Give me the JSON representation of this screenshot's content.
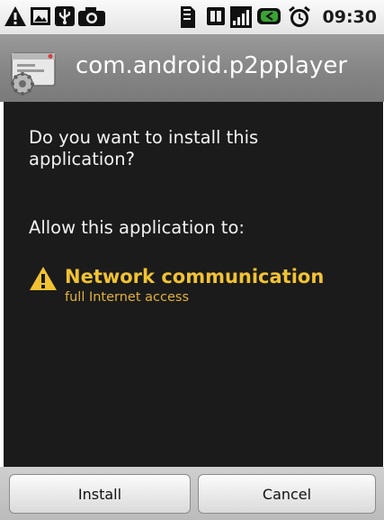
{
  "status_bar": {
    "icons": [
      "warning-icon",
      "image-icon",
      "usb-icon",
      "camera-icon",
      "sd-card-icon",
      "sim-card-icon",
      "signal-icon",
      "battery-icon",
      "alarm-icon"
    ],
    "time": "09:30"
  },
  "title_bar": {
    "icon": "package-install-icon",
    "title": "com.android.p2pplayer"
  },
  "body": {
    "question": "Do you want to install this application?",
    "allow_heading": "Allow this application to:",
    "permissions": [
      {
        "icon": "warning-icon",
        "title": "Network communication",
        "subtitle": "full Internet access"
      }
    ]
  },
  "buttons": {
    "install": "Install",
    "cancel": "Cancel"
  },
  "colors": {
    "permission_title": "#f1c232",
    "permission_subtitle": "#e0b23c",
    "panel_background": "#1b1b1b",
    "title_bar": "#8c8c8c"
  }
}
